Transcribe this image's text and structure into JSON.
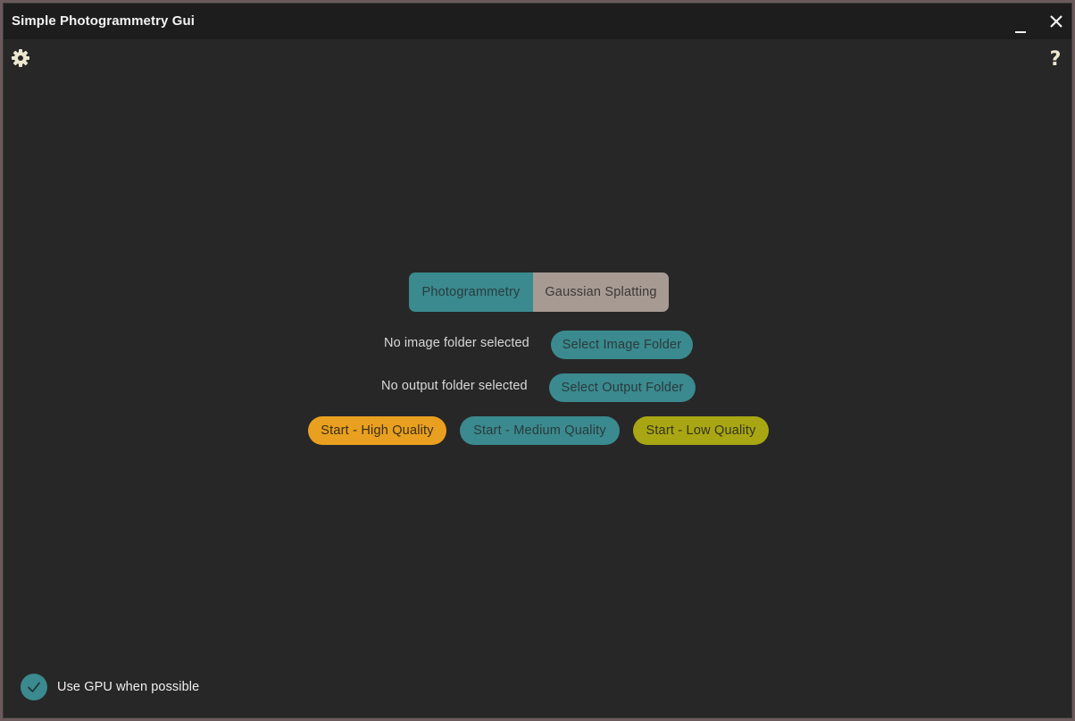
{
  "window": {
    "title": "Simple Photogrammetry Gui",
    "controls": [
      "minimize-icon",
      "close-icon"
    ]
  },
  "toolbar": {
    "settings_icon": "gear-icon",
    "help_icon": "help-icon"
  },
  "mode": {
    "options": [
      "Photogrammetry",
      "Gaussian Splatting"
    ],
    "selected": "Photogrammetry"
  },
  "image_folder": {
    "status": "No image folder selected",
    "button": "Select Image Folder"
  },
  "output_folder": {
    "status": "No output folder selected",
    "button": "Select Output Folder"
  },
  "start": {
    "high": "Start - High Quality",
    "medium": "Start - Medium Quality",
    "low": "Start - Low Quality"
  },
  "gpu": {
    "label": "Use GPU when possible",
    "checked": true
  },
  "colors": {
    "accent_teal": "#3a8a8f",
    "high_orange": "#e9a020",
    "low_olive": "#a9a614",
    "unselected_tab": "#a79a93",
    "background": "#272727",
    "titlebar": "#1d1d1d"
  }
}
